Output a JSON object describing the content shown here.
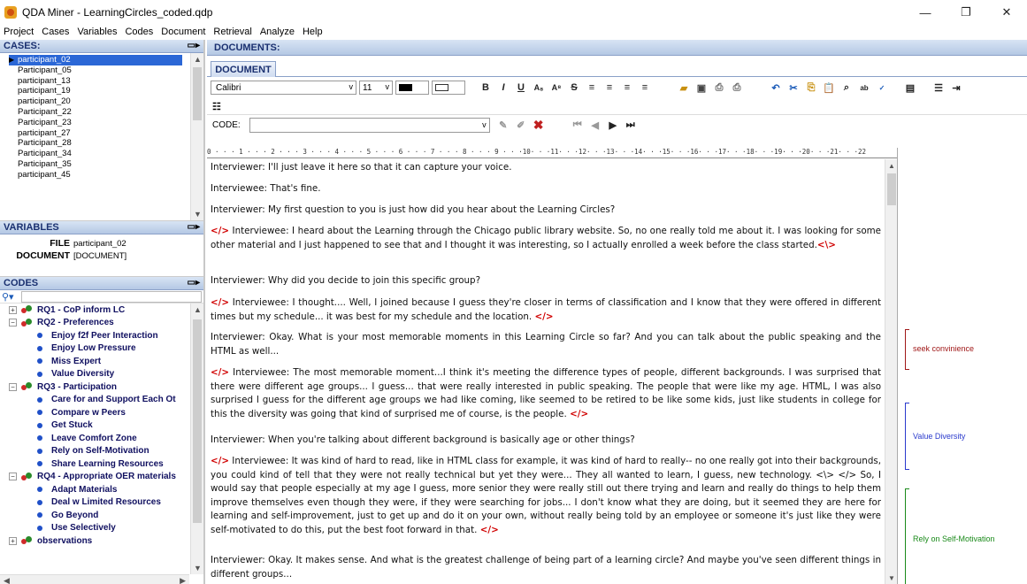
{
  "window": {
    "title": "QDA Miner - LearningCircles_coded.qdp",
    "minimize": "—",
    "maximize": "❐",
    "close": "✕"
  },
  "menu": [
    "Project",
    "Cases",
    "Variables",
    "Codes",
    "Document",
    "Retrieval",
    "Analyze",
    "Help"
  ],
  "cases": {
    "header": "CASES:",
    "items": [
      "participant_02",
      "Participant_05",
      "participant_13",
      "participant_19",
      "participant_20",
      "Participant_22",
      "Participant_23",
      "participant_27",
      "Participant_28",
      "Participant_34",
      "Participant_35",
      "participant_45"
    ]
  },
  "variables": {
    "header": "VARIABLES",
    "rows": [
      {
        "key": "FILE",
        "value": "participant_02"
      },
      {
        "key": "DOCUMENT",
        "value": "[DOCUMENT]"
      }
    ]
  },
  "codes": {
    "header": "CODES",
    "tree": [
      {
        "label": "RQ1 - CoP inform LC",
        "expand": "+",
        "children": []
      },
      {
        "label": "RQ2 - Preferences",
        "expand": "−",
        "children": [
          "Enjoy f2f Peer Interaction",
          "Enjoy Low Pressure",
          "Miss Expert",
          "Value Diversity"
        ]
      },
      {
        "label": "RQ3 - Participation",
        "expand": "−",
        "children": [
          "Care for and Support Each Ot",
          "Compare w Peers",
          "Get Stuck",
          "Leave Comfort Zone",
          "Rely on Self-Motivation",
          "Share Learning Resources"
        ]
      },
      {
        "label": "RQ4 - Appropriate OER materials",
        "expand": "−",
        "children": [
          "Adapt Materials",
          "Deal w Limited Resources",
          "Go Beyond",
          "Use Selectively"
        ]
      },
      {
        "label": "observations",
        "expand": "+",
        "children": []
      }
    ]
  },
  "documents": {
    "header": "DOCUMENTS:",
    "tab": "DOCUMENT",
    "font": "Calibri",
    "size": "11",
    "code_label": "CODE:",
    "ruler": "0 · · · 1 · · · 2 · · · 3 · · · 4 · · · 5 · · · 6 · · · 7 · · · 8 · · · 9 · · ·10· · ·11· · ·12· · ·13· · ·14· · ·15· · ·16· · ·17· · ·18· · ·19· · ·20· · ·21· · ·22"
  },
  "paragraphs": [
    {
      "tag_open": "",
      "text": "Interviewer: I'll just leave it here so that it can capture your voice.",
      "tag_close": ""
    },
    {
      "tag_open": "",
      "text": "Interviewee: That's fine.",
      "tag_close": ""
    },
    {
      "tag_open": "",
      "text": "Interviewer: My first question to you is just how did you hear about the Learning Circles?",
      "tag_close": ""
    },
    {
      "tag_open": "</>",
      "text": " Interviewee: I heard about the Learning through the Chicago public library website. So, no one really told me about it. I was looking for some other material and I just happened to see that and I thought it was interesting, so I actually enrolled a week before the class started.",
      "tag_close": "<\\>"
    },
    {
      "tag_open": "",
      "text": "Interviewer: Why did you decide to join this specific group?",
      "tag_close": ""
    },
    {
      "tag_open": "</>",
      "text": " Interviewee: I thought.... Well, I joined because I guess they're closer in terms of classification and I know that they were offered in different times but my schedule... it was best for my schedule and the location. ",
      "tag_close": "</>"
    },
    {
      "tag_open": "",
      "text": "Interviewer: Okay. What is your most memorable moments in this Learning Circle so far? And you can talk about the public speaking and the HTML as well...",
      "tag_close": ""
    },
    {
      "tag_open": "</>",
      "text": " Interviewee: The most memorable moment...I think it's meeting the difference types of people, different backgrounds. I was surprised that there were different age groups... I guess... that were really interested in public speaking. The people that were like my age. HTML, I was also surprised I guess for the different age groups we had like coming, like seemed to be retired to be like some kids, just like students in college for this the diversity was going that kind of surprised me of course, is the people. ",
      "tag_close": "</>"
    },
    {
      "tag_open": "",
      "text": "Interviewer: When you're talking about different background is basically age or other things?",
      "tag_close": ""
    },
    {
      "tag_open": "</>",
      "text": " Interviewee: It was kind of hard to read, like in HTML class for example, it was kind of hard to really-- no one really got into their backgrounds, you could kind of tell that they were not really technical but yet they were... They all wanted to learn, I guess, new technology. <\\> </> So, I would say that people especially at my age I guess, more senior they were really still out there trying and learn and really do things to help them improve themselves even though they were, if they were searching for jobs... I don't know what they are doing, but it seemed they are here for learning and self-improvement, just to get up and do it on your own, without really being told by an employee or someone it's just like they were self-motivated to do this, put the best foot forward in that. ",
      "tag_close": "</>"
    },
    {
      "tag_open": "",
      "text": "Interviewer: Okay. It makes sense. And what is the greatest challenge of being part of a learning circle? And maybe you've seen different things in different groups...",
      "tag_close": ""
    }
  ],
  "margin_codes": [
    {
      "label": "seek convinience",
      "color": "#a01818"
    },
    {
      "label": "Value Diversity",
      "color": "#2a3acc"
    },
    {
      "label": "Rely on Self-Motivation",
      "color": "#1a8a1a"
    }
  ]
}
